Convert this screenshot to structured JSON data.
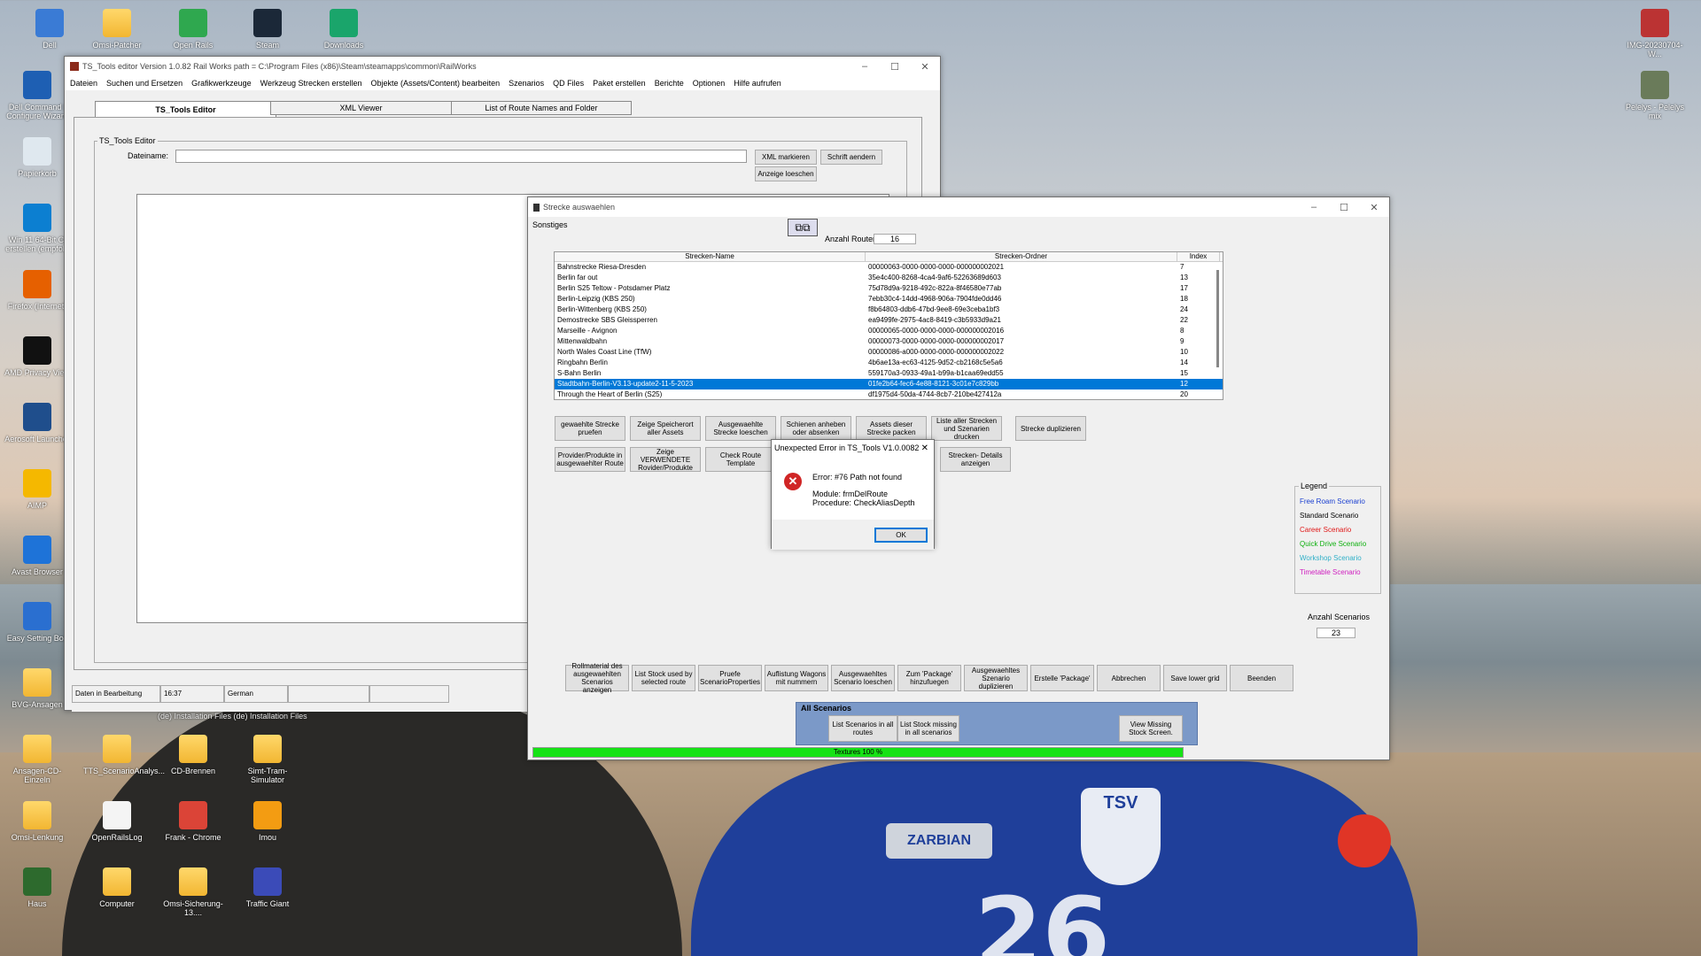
{
  "desktop_icons": [
    {
      "label": "Dell",
      "color": "#3a7bd5"
    },
    {
      "label": "Omsi-Patcher",
      "color": "folder"
    },
    {
      "label": "Open Rails",
      "color": "#2fa84f"
    },
    {
      "label": "Steam",
      "color": "#1b2838"
    },
    {
      "label": "Downloads",
      "color": "#1aa56b"
    },
    {
      "label": "Dell Command | Configure Wizard",
      "color": "#1e5fb3"
    },
    {
      "label": "Papierkorb",
      "color": "#dfe8ef"
    },
    {
      "label": "Win 11 64-Bit Cl erstellen (empfohl",
      "color": "#0c7fd1"
    },
    {
      "label": "Firefox (Internet)",
      "color": "#e66000"
    },
    {
      "label": "AMD Privacy View",
      "color": "#111"
    },
    {
      "label": "Aerosoft Launcher",
      "color": "#1f4e8c"
    },
    {
      "label": "AIMP",
      "color": "#f5b800"
    },
    {
      "label": "Avast Browser",
      "color": "#1e73d8"
    },
    {
      "label": "Easy Setting Box",
      "color": "#2a6fd0"
    },
    {
      "label": "BVG-Ansagen",
      "color": "folder"
    },
    {
      "label": "Ansagen-CD-Einzeln",
      "color": "folder"
    },
    {
      "label": "TTS_ScenarioAnalys...",
      "color": "folder"
    },
    {
      "label": "CD-Brennen",
      "color": "folder"
    },
    {
      "label": "Simt-Tram-Simulator",
      "color": "folder"
    },
    {
      "label": "Omsi-Lenkung",
      "color": "folder"
    },
    {
      "label": "OpenRailsLog",
      "color": "#f4f4f4"
    },
    {
      "label": "Frank - Chrome",
      "color": "#db4437"
    },
    {
      "label": "Imou",
      "color": "#f39c12"
    },
    {
      "label": "Haus",
      "color": "#2d6a2d"
    },
    {
      "label": "Computer",
      "color": "folder"
    },
    {
      "label": "Omsi-Sicherung-13....",
      "color": "folder"
    },
    {
      "label": "Traffic Giant",
      "color": "#3b4bb8"
    },
    {
      "label": "IMG-20230704-W...",
      "color": "#b33"
    },
    {
      "label": "Pelelys - Pelelys mix",
      "color": "#6a7b5a"
    }
  ],
  "ts_window": {
    "title": "TS_Tools editor  Version 1.0.82   Rail Works path = C:\\Program Files (x86)\\Steam\\steamapps\\common\\RailWorks",
    "menu": [
      "Dateien",
      "Suchen und Ersetzen",
      "Grafikwerkzeuge",
      "Werkzeug Strecken erstellen",
      "Objekte (Assets/Content) bearbeiten",
      "Szenarios",
      "QD Files",
      "Paket erstellen",
      "Berichte",
      "Optionen",
      "Hilfe aufrufen"
    ],
    "tabs": [
      "TS_Tools Editor",
      "XML Viewer",
      "List of Route Names and Folder"
    ],
    "group_label": "TS_Tools Editor",
    "dateiname_label": "Dateiname:",
    "dateiname_value": "",
    "btn_xml": "XML markieren",
    "btn_schrift": "Schrift aendern",
    "btn_anzeige": "Anzeige loeschen",
    "status": [
      "Daten in Bearbeitung",
      "16:37",
      "German",
      "",
      ""
    ]
  },
  "strecke_window": {
    "title": "Strecke auswaehlen",
    "menu": "Sonstiges",
    "anzahl_label": "Anzahl Routen",
    "anzahl_value": "16",
    "columns": [
      "Strecken-Name",
      "Strecken-Ordner",
      "Index"
    ],
    "rows": [
      [
        "Bahnstrecke Riesa-Dresden",
        "00000063-0000-0000-0000-000000002021",
        "7"
      ],
      [
        "Berlin far out",
        "35e4c400-8268-4ca4-9af6-52263689d603",
        "13"
      ],
      [
        "Berlin S25 Teltow - Potsdamer Platz",
        "75d78d9a-9218-492c-822a-8f46580e77ab",
        "17"
      ],
      [
        "Berlin-Leipzig (KBS 250)",
        "7ebb30c4-14dd-4968-906a-7904fde0dd46",
        "18"
      ],
      [
        "Berlin-Wittenberg (KBS 250)",
        "f8b64803-ddb6-47bd-9ee8-69e3ceba1bf3",
        "24"
      ],
      [
        "Demostrecke SBS Gleissperren",
        "ea9499fe-2975-4ac8-8419-c3b5933d9a21",
        "22"
      ],
      [
        "Marseille - Avignon",
        "00000065-0000-0000-0000-000000002016",
        "8"
      ],
      [
        "Mittenwaldbahn",
        "00000073-0000-0000-0000-000000002017",
        "9"
      ],
      [
        "North Wales Coast Line (TfW)",
        "00000086-a000-0000-0000-000000002022",
        "10"
      ],
      [
        "Ringbahn Berlin",
        "4b6ae13a-ec63-4125-9d52-cb2168c5e5a6",
        "14"
      ],
      [
        "S-Bahn Berlin",
        "559170a3-0933-49a1-b99a-b1caa69edd55",
        "15"
      ],
      [
        "Stadtbahn-Berlin-V3.13-update2-11-5-2023",
        "01fe2b64-fec6-4e88-8121-3c01e7c829bb",
        "12"
      ],
      [
        "Through the Heart of Berlin (S25)",
        "df1975d4-50da-4744-8cb7-210be427412a",
        "20"
      ]
    ],
    "selected_row": 11,
    "buttons_row1": [
      "gewaehlte Strecke pruefen",
      "Zeige Speicherort aller Assets",
      "Ausgewaehlte Strecke loeschen",
      "Schienen anheben oder absenken",
      "Assets dieser Strecke packen",
      "Liste aller Strecken und Szenarien drucken",
      "Strecke duplizieren"
    ],
    "buttons_row2": [
      "Provider/Produkte in ausgewaehlter Route",
      "Zeige VERWENDETE Rovider/Produkte",
      "Check Route Template",
      "Strecken- Details anzeigen"
    ],
    "legend_title": "Legend",
    "legend": [
      {
        "label": "Free Roam Scenario",
        "color": "#1a3fd0"
      },
      {
        "label": "Standard Scenario",
        "color": "#000000"
      },
      {
        "label": "Career Scenario",
        "color": "#e01818"
      },
      {
        "label": "Quick Drive Scenario",
        "color": "#10b010"
      },
      {
        "label": "Workshop Scenario",
        "color": "#30b0c8"
      },
      {
        "label": "Timetable Scenario",
        "color": "#d020c0"
      }
    ],
    "anzahl_scen_label": "Anzahl Scenarios",
    "anzahl_scen_value": "23",
    "bottom_buttons": [
      "Rollmaterial des ausgewaehlten Scenarios anzeigen",
      "List Stock used by selected route",
      "Pruefe ScenarioProperties",
      "Auflistung Wagons mit nummern",
      "Ausgewaehltes Scenario loeschen",
      "Zum 'Package' hinzufuegen",
      "Ausgewaehltes Szenario duplizieren",
      "Erstelle 'Package'",
      "Abbrechen",
      "Save lower grid",
      "Beenden"
    ],
    "all_scenarios_label": "All Scenarios",
    "all_buttons": [
      "List Scenarios in all routes",
      "List Stock missing in all scenarios",
      "View Missing Stock Screen."
    ],
    "progress_label": "Textures 100 %",
    "progress_value": 100
  },
  "error_dialog": {
    "title": "Unexpected Error in TS_Tools V1.0.0082",
    "line1": "Error: #76 Path not found",
    "line2": "Module: frmDelRoute",
    "line3": "Procedure: CheckAliasDepth",
    "ok": "OK"
  },
  "underlay_text": "(de) Installation Files   (de) Installation Files"
}
